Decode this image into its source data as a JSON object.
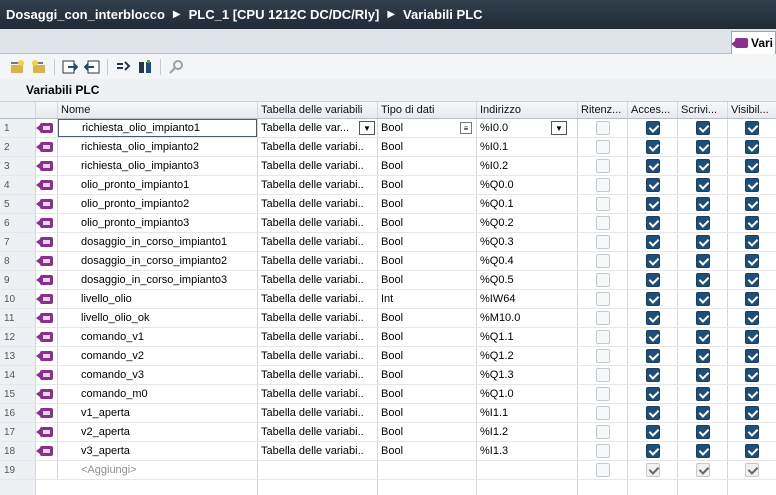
{
  "breadcrumb": [
    "Dosaggi_con_interblocco",
    "PLC_1 [CPU 1212C DC/DC/Rly]",
    "Variabili PLC"
  ],
  "tab": {
    "label": "Vari",
    "icon": "tag-table-icon"
  },
  "toolbar": {
    "buttons": [
      "add-tag-icon",
      "insert-tag-icon",
      "export-icon",
      "import-icon",
      "monitor-icon",
      "refresh-icon",
      "settings-icon"
    ]
  },
  "section_title": "Variabili PLC",
  "columns": {
    "name": "Nome",
    "table": "Tabella delle variabili",
    "type": "Tipo di dati",
    "address": "Indirizzo",
    "retain": "Ritenz...",
    "access": "Acces...",
    "write": "Scrivi...",
    "visible": "Visibil..."
  },
  "rows": [
    {
      "n": "1",
      "name": "richiesta_olio_impianto1",
      "table": "Tabella delle var...",
      "type": "Bool",
      "addr": "%I0.0"
    },
    {
      "n": "2",
      "name": "richiesta_olio_impianto2",
      "table": "Tabella delle variabi..",
      "type": "Bool",
      "addr": "%I0.1"
    },
    {
      "n": "3",
      "name": "richiesta_olio_impianto3",
      "table": "Tabella delle variabi..",
      "type": "Bool",
      "addr": "%I0.2"
    },
    {
      "n": "4",
      "name": "olio_pronto_impianto1",
      "table": "Tabella delle variabi..",
      "type": "Bool",
      "addr": "%Q0.0"
    },
    {
      "n": "5",
      "name": "olio_pronto_impianto2",
      "table": "Tabella delle variabi..",
      "type": "Bool",
      "addr": "%Q0.1"
    },
    {
      "n": "6",
      "name": "olio_pronto_impianto3",
      "table": "Tabella delle variabi..",
      "type": "Bool",
      "addr": "%Q0.2"
    },
    {
      "n": "7",
      "name": "dosaggio_in_corso_impianto1",
      "table": "Tabella delle variabi..",
      "type": "Bool",
      "addr": "%Q0.3"
    },
    {
      "n": "8",
      "name": "dosaggio_in_corso_impianto2",
      "table": "Tabella delle variabi..",
      "type": "Bool",
      "addr": "%Q0.4"
    },
    {
      "n": "9",
      "name": "dosaggio_in_corso_impianto3",
      "table": "Tabella delle variabi..",
      "type": "Bool",
      "addr": "%Q0.5"
    },
    {
      "n": "10",
      "name": "livello_olio",
      "table": "Tabella delle variabi..",
      "type": "Int",
      "addr": "%IW64"
    },
    {
      "n": "11",
      "name": "livello_olio_ok",
      "table": "Tabella delle variabi..",
      "type": "Bool",
      "addr": "%M10.0"
    },
    {
      "n": "12",
      "name": "comando_v1",
      "table": "Tabella delle variabi..",
      "type": "Bool",
      "addr": "%Q1.1"
    },
    {
      "n": "13",
      "name": "comando_v2",
      "table": "Tabella delle variabi..",
      "type": "Bool",
      "addr": "%Q1.2"
    },
    {
      "n": "14",
      "name": "comando_v3",
      "table": "Tabella delle variabi..",
      "type": "Bool",
      "addr": "%Q1.3"
    },
    {
      "n": "15",
      "name": "comando_m0",
      "table": "Tabella delle variabi..",
      "type": "Bool",
      "addr": "%Q1.0"
    },
    {
      "n": "16",
      "name": "v1_aperta",
      "table": "Tabella delle variabi..",
      "type": "Bool",
      "addr": "%I1.1"
    },
    {
      "n": "17",
      "name": "v2_aperta",
      "table": "Tabella delle variabi..",
      "type": "Bool",
      "addr": "%I1.2"
    },
    {
      "n": "18",
      "name": "v3_aperta",
      "table": "Tabella delle variabi..",
      "type": "Bool",
      "addr": "%I1.3"
    }
  ],
  "add_row": {
    "n": "19",
    "placeholder": "<Aggiungi>"
  },
  "colors": {
    "accent": "#1d4f7a",
    "tag_icon": "#8b2f8f",
    "titlebar": "#2a3643"
  }
}
